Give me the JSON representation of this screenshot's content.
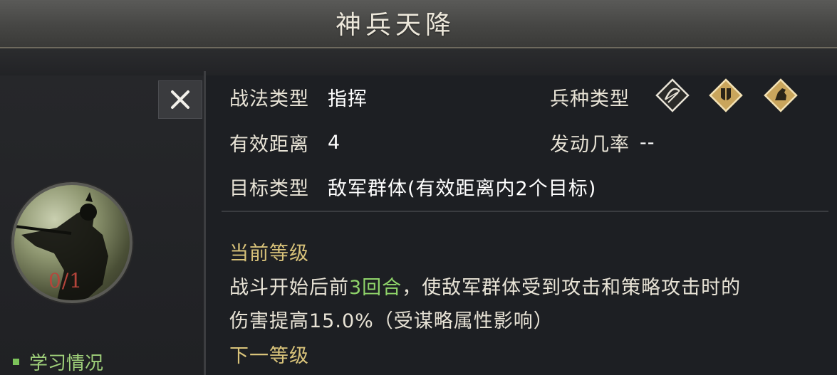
{
  "title": "神兵天降",
  "close_label": "✕",
  "skill": {
    "type_label": "战法类型",
    "type_value": "指挥",
    "range_label": "有效距离",
    "range_value": "4",
    "target_label": "目标类型",
    "target_value": "敌军群体(有效距离内2个目标)",
    "troop_label": "兵种类型",
    "troop_icons": [
      "bow-icon",
      "shield-icon",
      "horse-icon"
    ],
    "rate_label": "发动几率",
    "rate_value": "--"
  },
  "current_level": {
    "heading": "当前等级",
    "line1_pre": "战斗开始后前",
    "line1_hl": "3回合",
    "line1_post": "，使敌军群体受到攻击和策略攻击时的",
    "line2": "伤害提高15.0%（受谋略属性影响）"
  },
  "next_level": {
    "heading": "下一等级"
  },
  "avatar": {
    "counter": "0/1"
  },
  "learn_label": "学习情况",
  "colors": {
    "highlight": "#8fd46a",
    "section": "#d9c37a",
    "learn": "#9fd07a"
  }
}
